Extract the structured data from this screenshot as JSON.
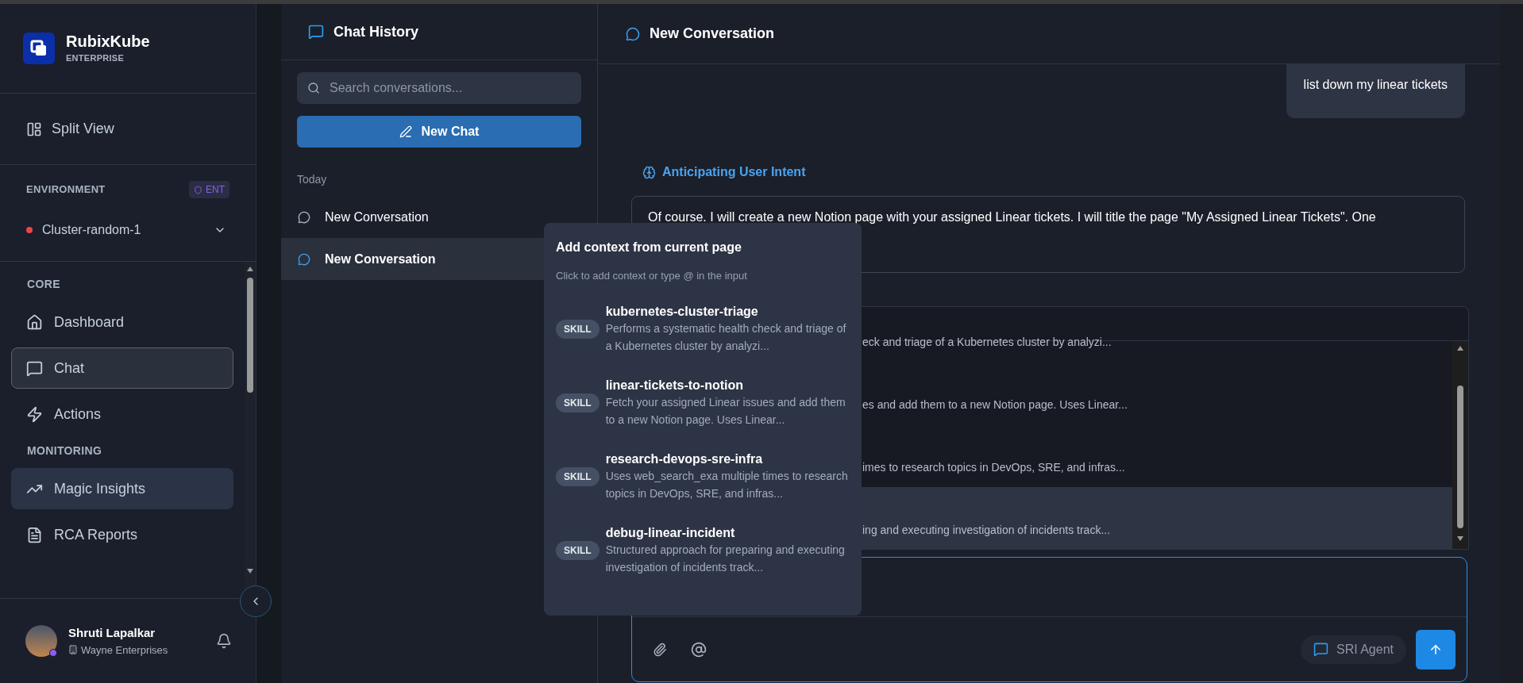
{
  "sidebar": {
    "brand": "RubixKube",
    "edition": "ENTERPRISE",
    "split_view": "Split View",
    "environment": {
      "label": "ENVIRONMENT",
      "badge": "ENT",
      "cluster": "Cluster-random-1"
    },
    "sections": [
      {
        "label": "CORE",
        "items": [
          {
            "label": "Dashboard",
            "selected": false,
            "hovered": false
          },
          {
            "label": "Chat",
            "selected": true,
            "hovered": false
          },
          {
            "label": "Actions",
            "selected": false,
            "hovered": false
          }
        ]
      },
      {
        "label": "MONITORING",
        "items": [
          {
            "label": "Magic Insights",
            "selected": false,
            "hovered": true
          },
          {
            "label": "RCA Reports",
            "selected": false,
            "hovered": false
          }
        ]
      }
    ],
    "user": {
      "name": "Shruti Lapalkar",
      "org": "Wayne Enterprises"
    }
  },
  "chat_history": {
    "title": "Chat History",
    "search": {
      "placeholder": "Search conversations..."
    },
    "new_chat": "New Chat",
    "groups": [
      {
        "label": "Today",
        "items": [
          {
            "title": "New Conversation",
            "selected": false
          },
          {
            "title": "New Conversation",
            "selected": true
          }
        ]
      }
    ]
  },
  "conversation": {
    "title": "New Conversation",
    "messages": [
      {
        "kind": "user",
        "text": "list down my linear tickets"
      },
      {
        "kind": "step",
        "text": "Anticipating User Intent"
      },
      {
        "kind": "assistant",
        "text": "Of course. I will create a new Notion page with your assigned Linear tickets. I will title the page \"My Assigned Linear Tickets\". One"
      }
    ],
    "suggestions": [
      {
        "text": "eck and triage of a Kubernetes cluster by analyzi...",
        "selected": false
      },
      {
        "text": "es and add them to a new Notion page. Uses Linear...",
        "selected": false
      },
      {
        "text": "imes to research topics in DevOps, SRE, and infras...",
        "selected": false
      },
      {
        "text": "ing and executing investigation of incidents track...",
        "selected": true
      }
    ],
    "composer": {
      "agent": "SRI Agent"
    }
  },
  "context_popup": {
    "title": "Add context from current page",
    "subtitle": "Click to add context or type @ in the input",
    "items": [
      {
        "tag": "SKILL",
        "name": "kubernetes-cluster-triage",
        "description": "Performs a systematic health check and triage of a Kubernetes cluster by analyzi..."
      },
      {
        "tag": "SKILL",
        "name": "linear-tickets-to-notion",
        "description": "Fetch your assigned Linear issues and add them to a new Notion page. Uses Linear..."
      },
      {
        "tag": "SKILL",
        "name": "research-devops-sre-infra",
        "description": "Uses web_search_exa multiple times to research topics in DevOps, SRE, and infras..."
      },
      {
        "tag": "SKILL",
        "name": "debug-linear-incident",
        "description": "Structured approach for preparing and executing investigation of incidents track..."
      }
    ]
  }
}
